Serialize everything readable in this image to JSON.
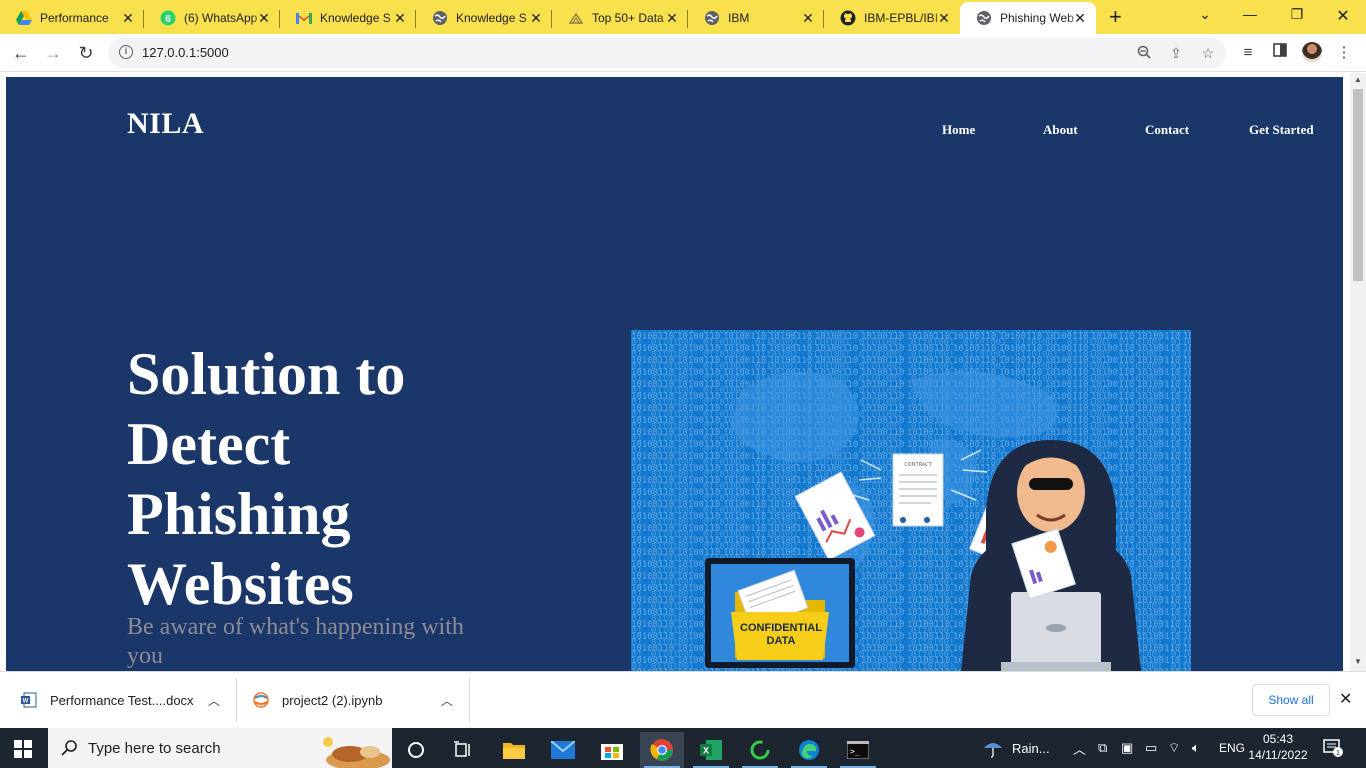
{
  "browser": {
    "tabs": [
      {
        "title": "Performance",
        "icon": "google-drive-icon",
        "active": false
      },
      {
        "title": "(6) WhatsApp",
        "icon": "whatsapp-icon",
        "active": false
      },
      {
        "title": "Knowledge S",
        "icon": "gmail-icon",
        "active": false
      },
      {
        "title": "Knowledge S",
        "icon": "globe-icon",
        "active": false
      },
      {
        "title": "Top 50+ Data",
        "icon": "cloud-icon",
        "active": false
      },
      {
        "title": "IBM",
        "icon": "globe-icon",
        "active": false
      },
      {
        "title": "IBM-EPBL/IBI",
        "icon": "github-icon",
        "active": false
      },
      {
        "title": "Phishing Web",
        "icon": "globe-icon",
        "active": true
      }
    ],
    "url": "127.0.0.1:5000",
    "colors": {
      "tabstrip": "#f9e04d",
      "site_bg": "#1b3668"
    }
  },
  "site": {
    "brand": "NILA",
    "nav": [
      "Home",
      "About",
      "Contact",
      "Get Started"
    ],
    "hero_title": "Solution to Detect Phishing Websites",
    "hero_subtitle": "Be aware of what's happening with you",
    "illustration": {
      "folder_label_1": "CONFIDENTIAL",
      "folder_label_2": "DATA",
      "document_label": "CONTRACT"
    }
  },
  "downloads": {
    "items": [
      {
        "name": "Performance Test....docx",
        "icon": "word-doc-icon"
      },
      {
        "name": "project2 (2).ipynb",
        "icon": "notebook-icon"
      }
    ],
    "show_all": "Show all"
  },
  "taskbar": {
    "search_placeholder": "Type here to search",
    "weather": "Rain...",
    "language": "ENG",
    "time": "05:43",
    "date": "14/11/2022",
    "notification_count": "1"
  }
}
